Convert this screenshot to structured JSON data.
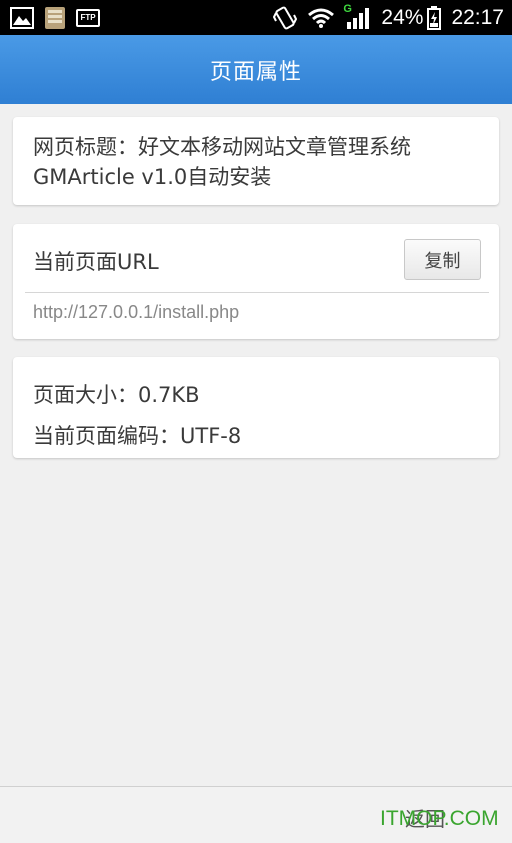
{
  "status_bar": {
    "icons_left": [
      "image-icon",
      "sd-card-icon",
      "ftp-icon"
    ],
    "ftp_label": "FTP",
    "icons_right": [
      "vibrate-icon",
      "wifi-icon",
      "signal-icon",
      "battery-charging-icon"
    ],
    "signal_label": "G",
    "battery_percent": "24%",
    "time": "22:17"
  },
  "header": {
    "title": "页面属性",
    "background_color": "#3b8ddc"
  },
  "page_title_card": {
    "text": "网页标题：好文本移动网站文章管理系统GMArticle v1.0自动安装"
  },
  "url_card": {
    "label": "当前页面URL",
    "copy_button": "复制",
    "url": "http://127.0.0.1/install.php"
  },
  "info_card": {
    "size": "页面大小：0.7KB",
    "encoding": "当前页面编码：UTF-8"
  },
  "bottom_bar": {
    "back_label": "返回",
    "watermark": "ITMOP.COM",
    "watermark_color": "#3aa52f"
  }
}
